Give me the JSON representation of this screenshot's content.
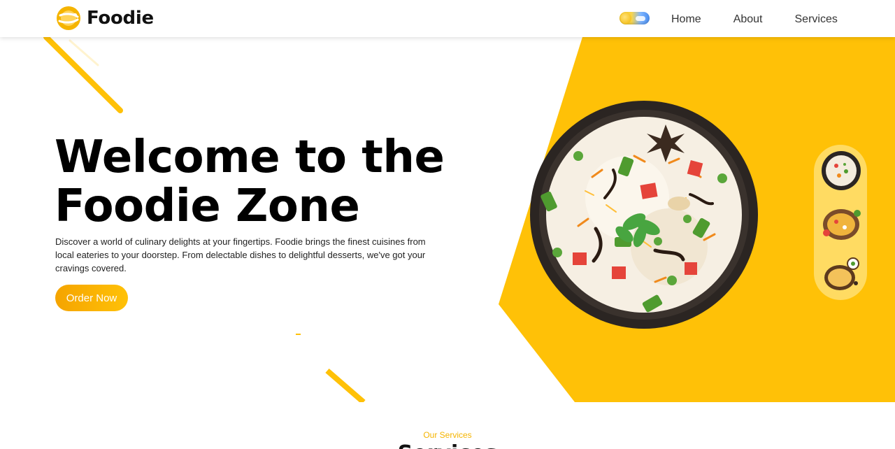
{
  "brand": {
    "name": "Foodie",
    "logo_icon": "fork-spoon-logo-icon"
  },
  "theme_toggle": {
    "icon": "sun-cloud-toggle-icon",
    "colors": {
      "sun": "#f2b600",
      "sky": "#4a8ef0"
    }
  },
  "nav": {
    "items": [
      "Home",
      "About",
      "Services"
    ]
  },
  "hero": {
    "title_line1": "Welcome to the",
    "title_line2": "Foodie Zone",
    "description": "Discover a world of culinary delights at your fingertips. Foodie brings the finest cuisines from local eateries to your doorstep. From delectable dishes to delightful desserts, we've got your cravings covered.",
    "cta_label": "Order Now",
    "main_image": "biryani-bowl-image",
    "thumbnails": [
      "biryani-bowl-thumbnail",
      "curry-plate-thumbnail",
      "rice-dish-thumbnail"
    ]
  },
  "services": {
    "subtitle": "Our Services",
    "title": "Services"
  },
  "colors": {
    "accent": "#ffc107",
    "accent_dark": "#f5a400",
    "strip": "#ffdb62",
    "text": "#111111"
  }
}
